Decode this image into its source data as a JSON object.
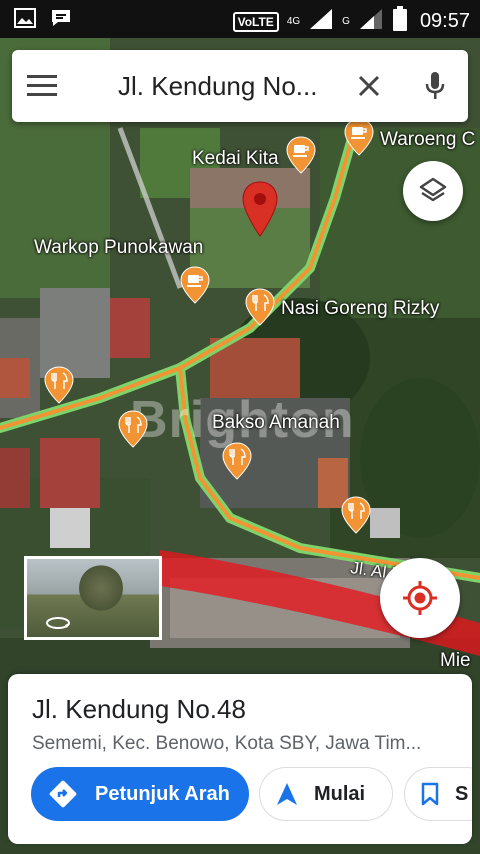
{
  "status_bar": {
    "volte": "VoLTE",
    "net_4g_label": "4G",
    "net_4g_sub": "4G",
    "net_g_label": "G",
    "time": "09:57"
  },
  "search": {
    "query": "Jl. Kendung No..."
  },
  "map": {
    "pois": [
      {
        "id": "kedai-kita",
        "label": "Kedai Kita",
        "icon": "cafe-icon"
      },
      {
        "id": "waroeng",
        "label": "Waroeng C",
        "icon": "restaurant-icon"
      },
      {
        "id": "warkop-punokawan",
        "label": "Warkop Punokawan",
        "icon": "cafe-icon"
      },
      {
        "id": "nasi-goreng-rizky",
        "label": "Nasi Goreng Rizky",
        "icon": "restaurant-icon"
      },
      {
        "id": "bakso-amanah",
        "label": "Bakso Amanah",
        "icon": "restaurant-icon"
      },
      {
        "id": "mie",
        "label": "Mie ",
        "icon": "restaurant-icon"
      }
    ],
    "road_label": "Jl. Al Falah",
    "watermark": "Brighton"
  },
  "place": {
    "title": "Jl. Kendung No.48",
    "address": "Sememi, Kec. Benowo, Kota SBY, Jawa Tim..."
  },
  "actions": {
    "directions": "Petunjuk Arah",
    "start": "Mulai",
    "save": "S"
  },
  "colors": {
    "primary": "#1a73e8",
    "pin_red": "#d93025",
    "poi_orange": "#f29433",
    "road_orange": "#f29433",
    "road_green": "#7ed36b",
    "highlight_red": "#e8141c"
  }
}
